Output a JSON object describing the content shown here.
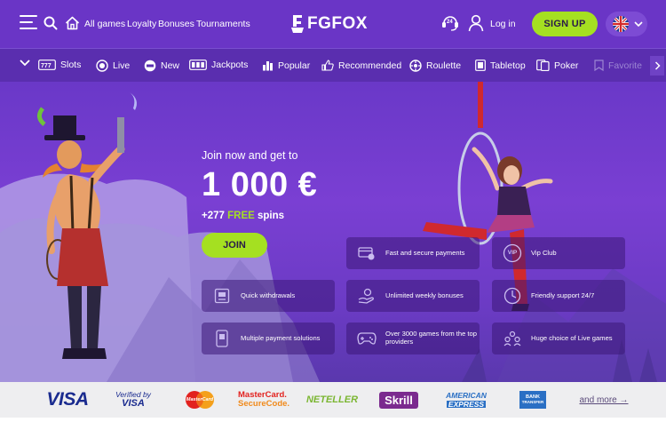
{
  "header": {
    "nav_links": [
      "All games",
      "Loyalty",
      "Bonuses",
      "Tournaments"
    ],
    "logo_text": "FGFOX",
    "support_badge": "24",
    "login_label": "Log in",
    "signup_label": "SIGN UP"
  },
  "categories": [
    "Slots",
    "Live",
    "New",
    "Jackpots",
    "Popular",
    "Recommended",
    "Roulette",
    "Tabletop",
    "Poker",
    "Favorite"
  ],
  "hero": {
    "tagline": "Join now and get to",
    "amount": "1 000 €",
    "spins_prefix": "+277",
    "spins_highlight": "FREE",
    "spins_suffix": "spins",
    "join_label": "JOIN"
  },
  "features": [
    "Fast and secure payments",
    "Vip Club",
    "Quick withdrawals",
    "Unlimited weekly bonuses",
    "Friendly support 24/7",
    "Multiple payment solutions",
    "Over 3000 games from the top providers",
    "Huge choice of Live games"
  ],
  "vip_badge": "VIP",
  "payments": {
    "visa": "VISA",
    "verified_top": "Verified by",
    "verified_bottom": "VISA",
    "mastercard": "MasterCard",
    "securecode_top": "MasterCard.",
    "securecode_bottom": "SecureCode.",
    "neteller": "NETELLER",
    "skrill": "Skrill",
    "amex_top": "AMERICAN",
    "amex_bottom": "EXPRESS",
    "bank_top": "BANK",
    "bank_bottom": "TRANSFER",
    "more_link": "and more →"
  },
  "colors": {
    "header_bg": "#6a35c6",
    "category_bg": "#5a2eaf",
    "accent_green": "#a5e021",
    "hero_bg": "#7a3fd3",
    "payments_bg": "#eeeef0"
  },
  "icons": [
    "menu-icon",
    "search-icon",
    "home-icon",
    "support-icon",
    "user-icon",
    "uk-flag-icon",
    "chevron-down-icon"
  ]
}
